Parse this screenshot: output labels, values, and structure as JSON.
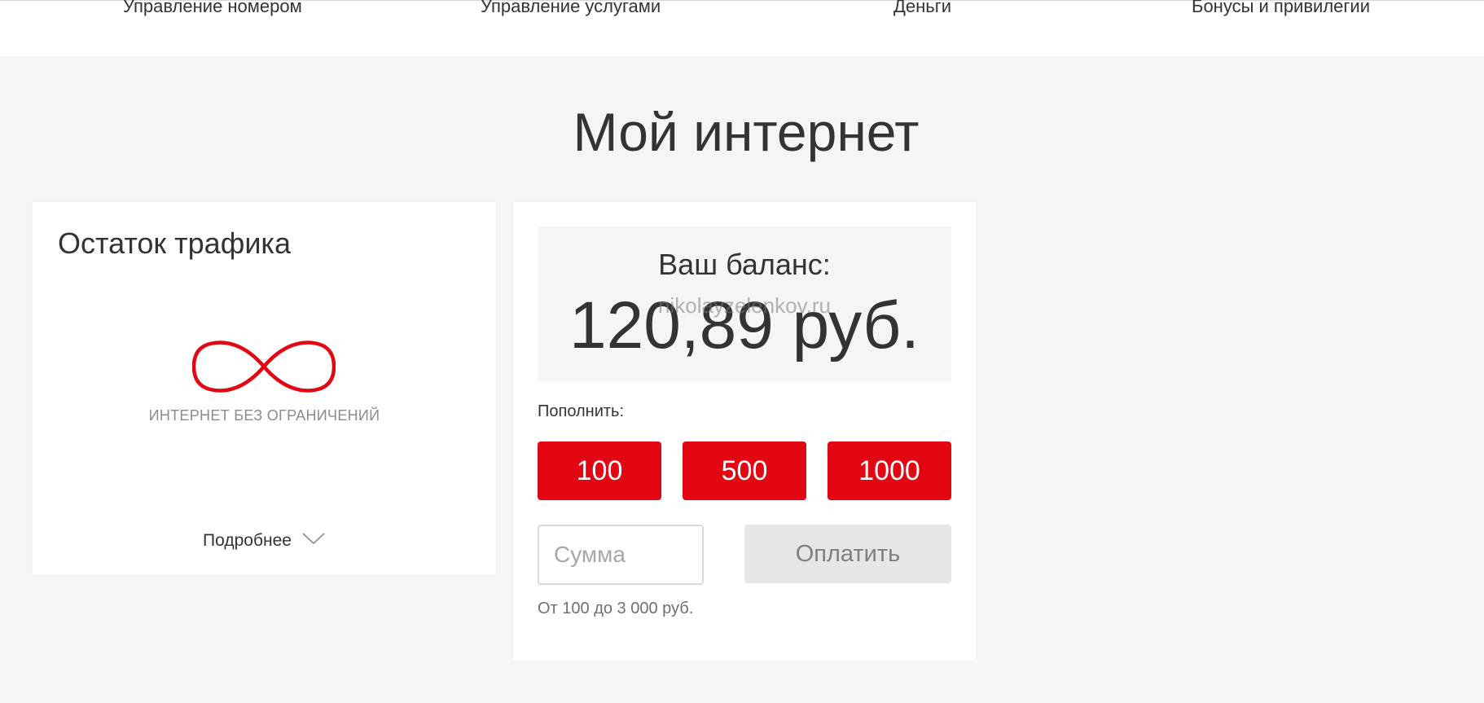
{
  "nav": {
    "items": [
      {
        "label": "Управление номером"
      },
      {
        "label": "Управление услугами"
      },
      {
        "label": "Деньги"
      },
      {
        "label": "Бонусы и привилегии"
      }
    ]
  },
  "page": {
    "title": "Мой интернет"
  },
  "traffic_card": {
    "title": "Остаток трафика",
    "icon": "infinity-icon",
    "unlimited_label": "ИНТЕРНЕТ БЕЗ ОГРАНИЧЕНИЙ",
    "details_label": "Подробнее"
  },
  "balance_card": {
    "balance_label": "Ваш баланс:",
    "balance_value": "120,89 руб.",
    "watermark": "nikolayzelenkov.ru",
    "topup_label": "Пополнить:",
    "amounts": [
      "100",
      "500",
      "1000"
    ],
    "sum_placeholder": "Сумма",
    "sum_value": "",
    "pay_label": "Оплатить",
    "range_hint": "От 100 до 3 000 руб."
  },
  "colors": {
    "accent": "#e30613",
    "background": "#f5f5f5",
    "card": "#ffffff",
    "text": "#333333",
    "muted": "#8b8b8b",
    "pay_button_bg": "#e6e6e6"
  }
}
